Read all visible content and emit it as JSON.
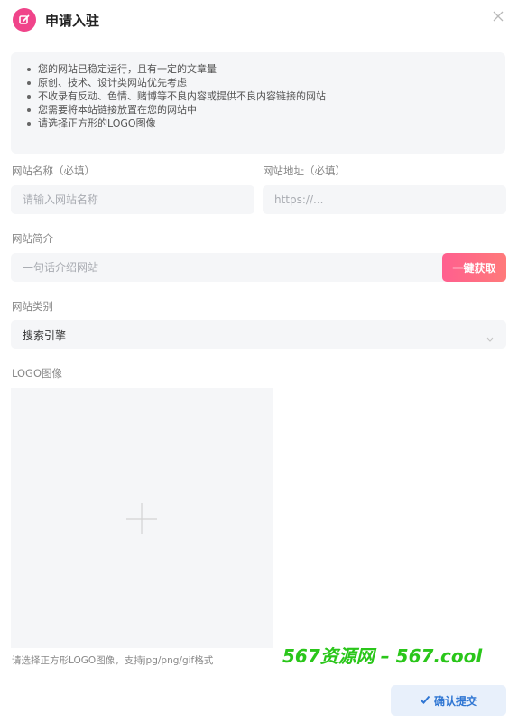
{
  "dialog": {
    "title": "申请入驻",
    "header_icon": "edit-icon",
    "close_icon": "close-icon",
    "accent_color": "#f0448a"
  },
  "notice": {
    "items": [
      "您的网站已稳定运行，且有一定的文章量",
      "原创、技术、设计类网站优先考虑",
      "不收录有反动、色情、赌博等不良内容或提供不良内容链接的网站",
      "您需要将本站链接放置在您的网站中",
      "请选择正方形的LOGO图像"
    ]
  },
  "form": {
    "site_name": {
      "label": "网站名称（必填）",
      "placeholder": "请输入网站名称",
      "value": ""
    },
    "site_url": {
      "label": "网站地址（必填）",
      "placeholder": "https://...",
      "value": ""
    },
    "site_desc": {
      "label": "网站简介",
      "placeholder": "一句话介绍网站",
      "value": "",
      "fetch_button": "一键获取"
    },
    "category": {
      "label": "网站类别",
      "value": "搜索引擎",
      "icon": "chevron-down-icon"
    },
    "logo": {
      "label": "LOGO图像",
      "icon": "plus-icon",
      "hint": "请选择正方形LOGO图像，支持jpg/png/gif格式"
    }
  },
  "watermark": "567资源网 – 567.cool",
  "submit": {
    "label": "确认提交",
    "icon": "check-icon",
    "color": "#2f76d3"
  }
}
